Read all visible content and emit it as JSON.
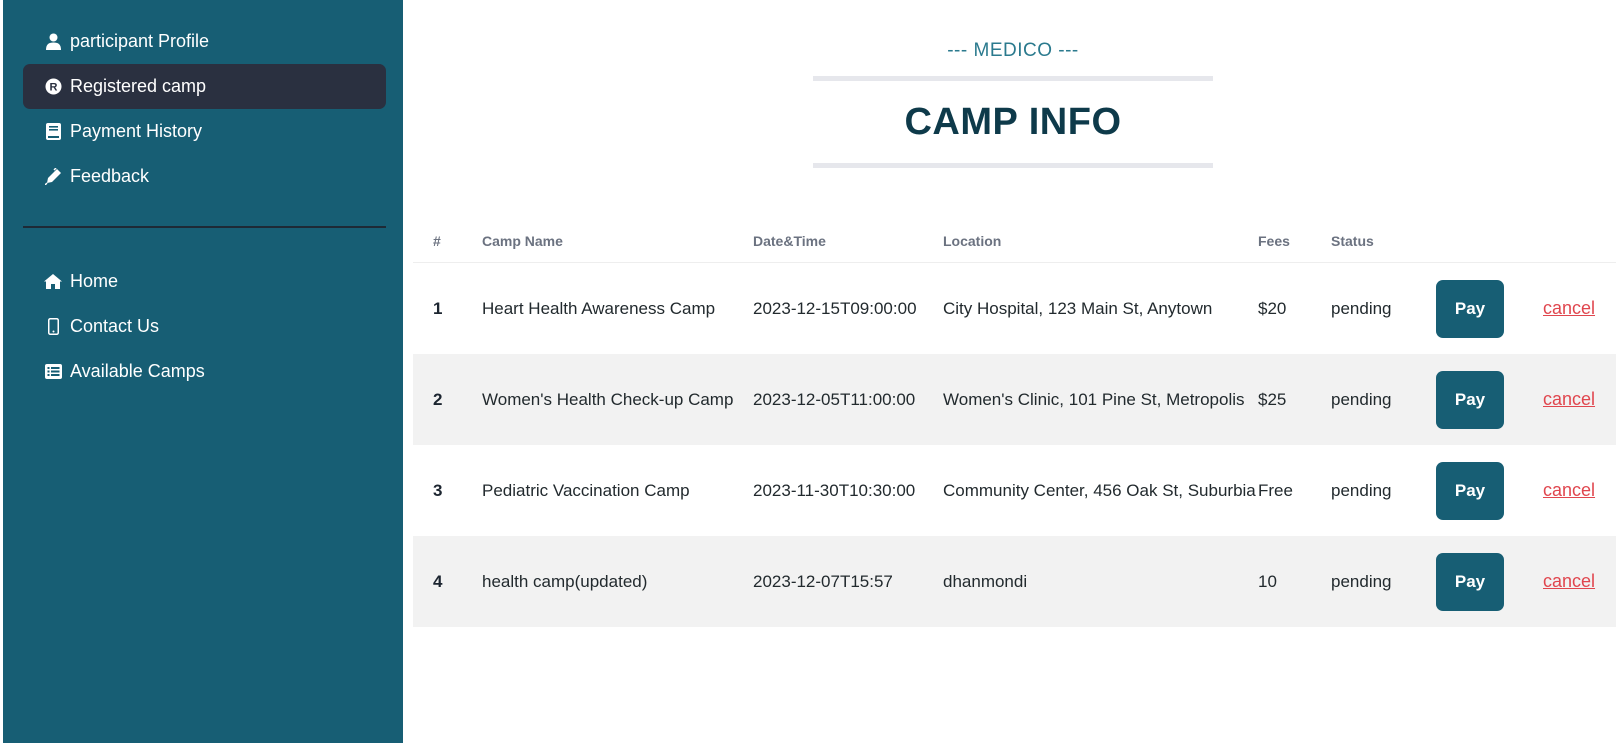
{
  "sidebar": {
    "top_items": [
      {
        "label": "participant Profile",
        "icon": "user-icon",
        "active": false
      },
      {
        "label": "Registered camp",
        "icon": "registered-icon",
        "active": true
      },
      {
        "label": "Payment History",
        "icon": "book-icon",
        "active": false
      },
      {
        "label": "Feedback",
        "icon": "pen-icon",
        "active": false
      }
    ],
    "bottom_items": [
      {
        "label": "Home",
        "icon": "home-icon"
      },
      {
        "label": "Contact Us",
        "icon": "mobile-icon"
      },
      {
        "label": "Available Camps",
        "icon": "list-icon"
      }
    ]
  },
  "header": {
    "subtitle": "--- MEDICO ---",
    "title": "CAMP INFO"
  },
  "table": {
    "columns": [
      "#",
      "Camp Name",
      "Date&Time",
      "Location",
      "Fees",
      "Status",
      "",
      ""
    ],
    "rows": [
      {
        "num": "1",
        "name": "Heart Health Awareness Camp",
        "datetime": "2023-12-15T09:00:00",
        "location": "City Hospital, 123 Main St, Anytown",
        "fees": "$20",
        "status": "pending",
        "pay": "Pay",
        "cancel": "cancel"
      },
      {
        "num": "2",
        "name": "Women's Health Check-up Camp",
        "datetime": "2023-12-05T11:00:00",
        "location": "Women's Clinic, 101 Pine St, Metropolis",
        "fees": "$25",
        "status": "pending",
        "pay": "Pay",
        "cancel": "cancel"
      },
      {
        "num": "3",
        "name": "Pediatric Vaccination Camp",
        "datetime": "2023-11-30T10:30:00",
        "location": "Community Center, 456 Oak St, Suburbia",
        "fees": "Free",
        "status": "pending",
        "pay": "Pay",
        "cancel": "cancel"
      },
      {
        "num": "4",
        "name": "health camp(updated)",
        "datetime": "2023-12-07T15:57",
        "location": "dhanmondi",
        "fees": "10",
        "status": "pending",
        "pay": "Pay",
        "cancel": "cancel"
      }
    ]
  },
  "colors": {
    "sidebar_bg": "#175e74",
    "active_item_bg": "#2a3040",
    "accent": "#175e74",
    "cancel_link": "#e0464e",
    "title": "#0e3a4a",
    "subtitle": "#2b7a8e"
  }
}
